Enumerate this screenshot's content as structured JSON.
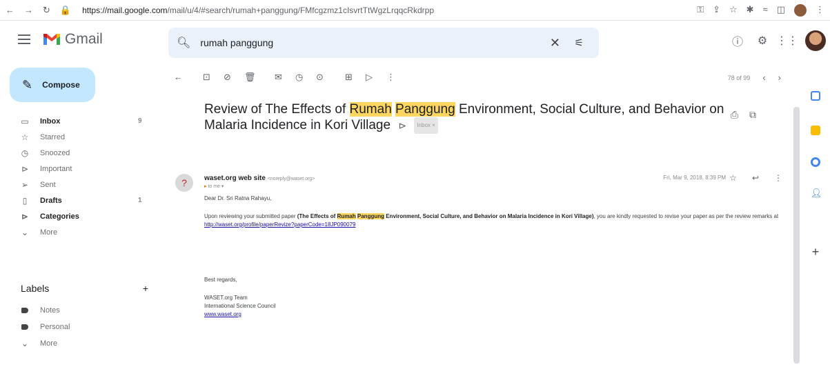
{
  "browser": {
    "url_host": "https://mail.google.com",
    "url_path": "/mail/u/4/#search/rumah+panggung/FMfcgzmz1cIsvrtTtWgzLrqqcRkdrpp"
  },
  "app": {
    "name": "Gmail"
  },
  "search": {
    "query": "rumah panggung"
  },
  "compose": {
    "label": "Compose"
  },
  "sidebar": {
    "items": [
      {
        "label": "Inbox",
        "count": "9",
        "icon": "inbox-icon"
      },
      {
        "label": "Starred",
        "icon": "star-icon"
      },
      {
        "label": "Snoozed",
        "icon": "clock-icon"
      },
      {
        "label": "Important",
        "icon": "label-important-icon"
      },
      {
        "label": "Sent",
        "icon": "send-icon"
      },
      {
        "label": "Drafts",
        "count": "1",
        "icon": "draft-icon"
      },
      {
        "label": "Categories",
        "icon": "category-icon"
      },
      {
        "label": "More",
        "icon": "chevron-down-icon"
      }
    ],
    "labels_heading": "Labels",
    "labels": [
      {
        "label": "Notes"
      },
      {
        "label": "Personal"
      },
      {
        "label": "More"
      }
    ]
  },
  "toolbar": {
    "pager_text": "78 of 99"
  },
  "email": {
    "subject_before": "Review of The Effects of ",
    "subject_hl1": "Rumah",
    "subject_space": " ",
    "subject_hl2": "Panggung",
    "subject_after": " Environment, Social Culture, and Behavior on Malaria Incidence in Kori Village",
    "inbox_chip": "Inbox ×",
    "sender_name": "waset.org web site",
    "sender_email": "<noreply@waset.org>",
    "to": "to me ▾",
    "date": "Fri, Mar 9, 2018, 8:39 PM",
    "greeting": "Dear Dr. Sri Ratna Rahayu,",
    "para_start": "Upon reviewing your submitted paper ",
    "para_bold1": "(The Effects of ",
    "para_hl1": "Rumah",
    "para_hl2": "Panggung",
    "para_bold2": " Environment, Social Culture, and Behavior on ",
    "para_bold3": "Malaria Incidence in Kori Village)",
    "para_end": ", you are kindly requested to revise your paper as per the review remarks at",
    "link": "http://waset.org/profile/paperRevize?paperCode=18JP090079",
    "closing": "Best regards,",
    "sig1": "WASET.org Team",
    "sig2": "International Science Council",
    "sig3": "www.waset.org"
  },
  "colors": {
    "compose_bg": "#c2e7ff",
    "search_bg": "#eaf1fb",
    "highlight": "#fcd65f",
    "link": "#1a0dab"
  }
}
